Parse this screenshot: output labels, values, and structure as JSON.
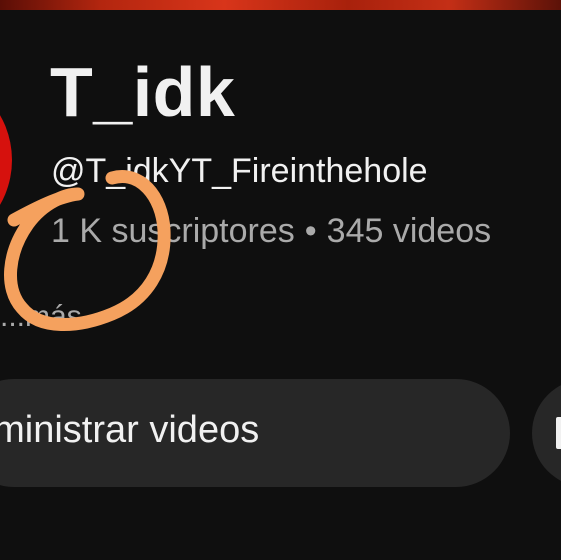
{
  "channel": {
    "name": "T_idk",
    "handle": "@T_idkYT_Fireinthehole",
    "subscribers": "1 K suscriptores",
    "separator": "•",
    "videos": "345 videos",
    "more_text": "...más"
  },
  "actions": {
    "manage_videos_label": "dministrar videos"
  },
  "colors": {
    "background": "#0f0f0f",
    "primary_text": "#f1f1f1",
    "secondary_text": "#aaaaaa",
    "button_bg": "#272727",
    "avatar_red": "#d6110d",
    "annotation_orange": "#f5a15e"
  },
  "annotation": {
    "icon": "hand-drawn-circle-icon"
  }
}
